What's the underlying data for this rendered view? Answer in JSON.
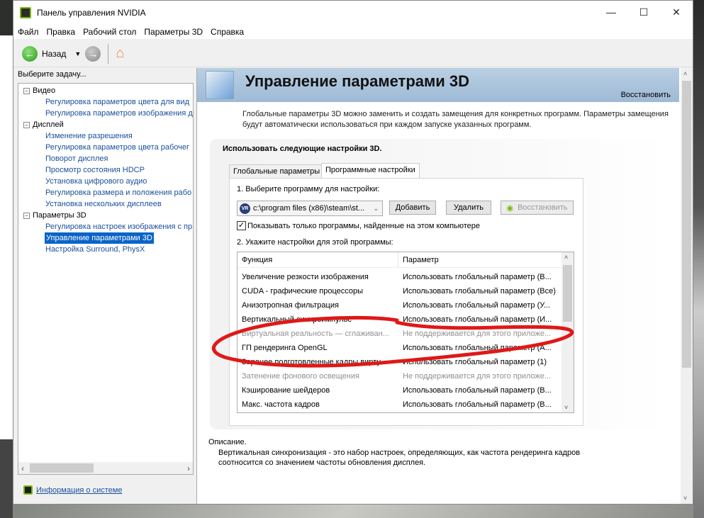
{
  "window": {
    "title": "Панель управления NVIDIA",
    "controls": [
      "—",
      "☐",
      "✕"
    ]
  },
  "menu": [
    "Файл",
    "Правка",
    "Рабочий стол",
    "Параметры 3D",
    "Справка"
  ],
  "toolbar": {
    "back": "Назад"
  },
  "left": {
    "heading": "Выберите задачу...",
    "tree": [
      {
        "label": "Видео",
        "children": [
          "Регулировка параметров цвета для вид",
          "Регулировка параметров изображения д"
        ]
      },
      {
        "label": "Дисплей",
        "children": [
          "Изменение разрешения",
          "Регулировка параметров цвета рабочег",
          "Поворот дисплея",
          "Просмотр состояния HDCP",
          "Установка цифрового аудио",
          "Регулировка размера и положения рабо",
          "Установка нескольких дисплеев"
        ]
      },
      {
        "label": "Параметры 3D",
        "children": [
          "Регулировка настроек изображения с пр",
          "Управление параметрами 3D",
          "Настройка Surround, PhysX"
        ]
      }
    ],
    "selected": "Управление параметрами 3D",
    "info_link": "Информация о системе"
  },
  "main": {
    "title": "Управление параметрами 3D",
    "restore": "Восстановить",
    "description": "Глобальные параметры 3D можно заменить и создать замещения для конкретных программ. Параметры замещения будут автоматически использоваться при каждом запуске указанных программ.",
    "group_title": "Использовать следующие настройки 3D.",
    "tabs": [
      {
        "label": "Глобальные параметры",
        "active": false
      },
      {
        "label": "Программные настройки",
        "active": true
      }
    ],
    "step1": "1. Выберите программу для настройки:",
    "program": "c:\\program files (x86)\\steam\\st...",
    "add": "Добавить",
    "remove": "Удалить",
    "restore_btn": "Восстановить",
    "show_only": "Показывать только программы, найденные на этом компьютере",
    "show_only_checked": true,
    "step2": "2. Укажите настройки для этой программы:",
    "columns": [
      "Функция",
      "Параметр"
    ],
    "rows": [
      {
        "f": "Увеличение резкости изображения",
        "p": "Использовать глобальный параметр (В...",
        "dim": false
      },
      {
        "f": "CUDA - графические процессоры",
        "p": "Использовать глобальный параметр (Все)",
        "dim": false
      },
      {
        "f": "Анизотропная фильтрация",
        "p": "Использовать глобальный параметр (У...",
        "dim": false
      },
      {
        "f": "Вертикальный синхроимпульс",
        "p": "Использовать глобальный параметр (И...",
        "dim": false
      },
      {
        "f": "Виртуальная реальность — сглаживан...",
        "p": "Не поддерживается для этого приложе...",
        "dim": true
      },
      {
        "f": "ГП рендеринга OpenGL",
        "p": "Использовать глобальный параметр (А...",
        "dim": false
      },
      {
        "f": "Заранее подготовленные кадры вирту...",
        "p": "Использовать глобальный параметр (1)",
        "dim": false
      },
      {
        "f": "Затенение фонового освещения",
        "p": "Не поддерживается для этого приложе...",
        "dim": true
      },
      {
        "f": "Кэширование шейдеров",
        "p": "Использовать глобальный параметр (В...",
        "dim": false
      },
      {
        "f": "Макс. частота кадров",
        "p": "Использовать глобальный параметр (В...",
        "dim": false
      }
    ],
    "desc_label": "Описание.",
    "desc_text": "Вертикальная синхронизация - это набор настроек, определяющих, как частота рендеринга кадров соотносится со значением частоты обновления дисплея."
  },
  "colors": {
    "accent": "#76b900",
    "selection": "#0a64c8",
    "annotation": "#e01818"
  }
}
